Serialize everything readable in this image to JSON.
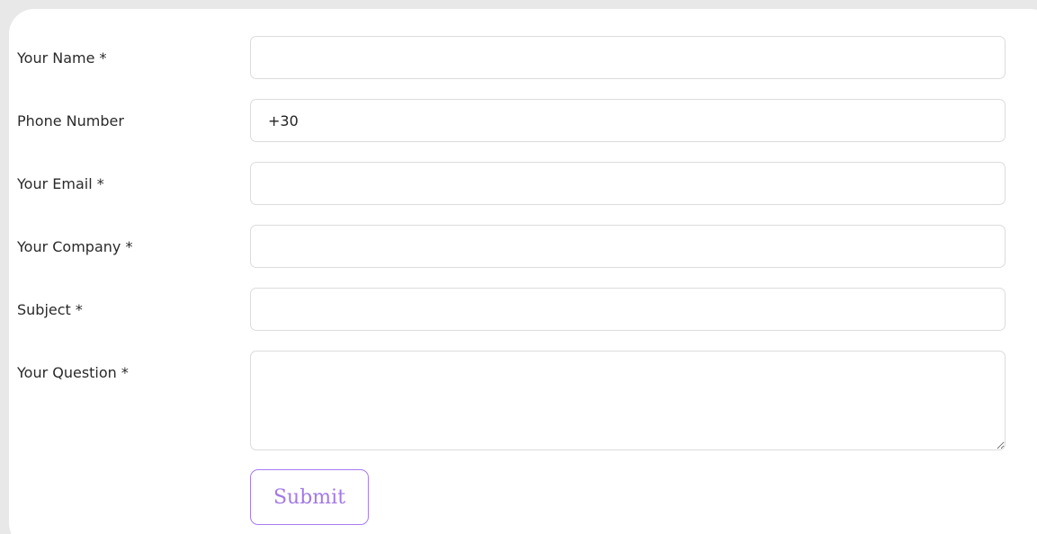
{
  "form": {
    "fields": [
      {
        "label": "Your Name *",
        "value": "",
        "type": "text"
      },
      {
        "label": "Phone Number",
        "value": "+30",
        "type": "tel"
      },
      {
        "label": "Your Email *",
        "value": "",
        "type": "email"
      },
      {
        "label": "Your Company *",
        "value": "",
        "type": "text"
      },
      {
        "label": "Subject *",
        "value": "",
        "type": "text"
      },
      {
        "label": "Your Question *",
        "value": "",
        "type": "textarea"
      }
    ],
    "submit_label": "Submit"
  },
  "colors": {
    "page_background": "#e8e8e8",
    "card_background": "#ffffff",
    "field_border": "#dcdcdc",
    "submit_accent": "#a77bf2"
  }
}
